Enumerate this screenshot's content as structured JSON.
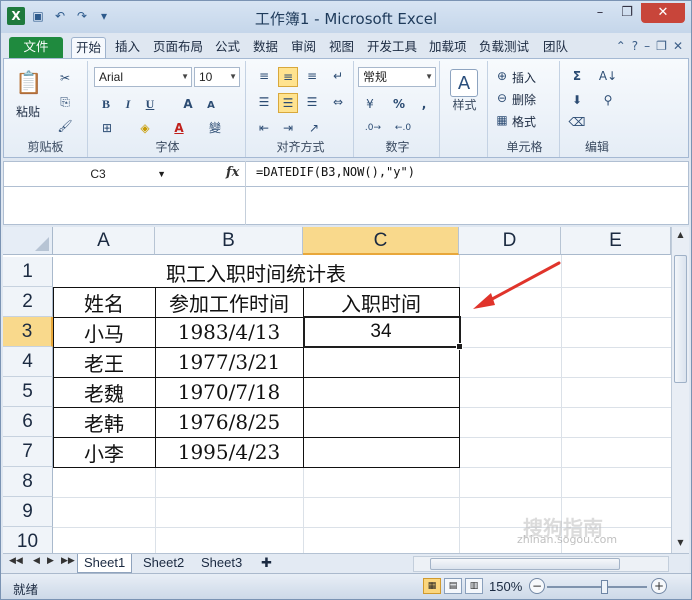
{
  "window": {
    "title": "工作簿1 - Microsoft Excel"
  },
  "ribbon_tabs": [
    "文件",
    "开始",
    "插入",
    "页面布局",
    "公式",
    "数据",
    "审阅",
    "视图",
    "开发工具",
    "加载项",
    "负载测试",
    "团队"
  ],
  "ribbon": {
    "clipboard": {
      "paste": "粘贴",
      "label": "剪贴板"
    },
    "font": {
      "name": "Arial",
      "size": "10",
      "bold": "B",
      "italic": "I",
      "underline": "U",
      "grow": "A",
      "shrink": "A",
      "font_color": "A",
      "phonetic": "變",
      "label": "字体"
    },
    "alignment": {
      "label": "对齐方式"
    },
    "number": {
      "format": "常规",
      "percent": "%",
      "comma": ",",
      "label": "数字"
    },
    "styles": {
      "label": "样式"
    },
    "cells": {
      "insert": "插入",
      "delete": "删除",
      "format": "格式",
      "label": "单元格"
    },
    "editing": {
      "label": "编辑"
    }
  },
  "formula_bar": {
    "name_box": "C3",
    "fx": "fx",
    "formula": "=DATEDIF(B3,NOW(),\"y\")"
  },
  "columns": [
    "A",
    "B",
    "C",
    "D",
    "E"
  ],
  "rows": [
    "1",
    "2",
    "3",
    "4",
    "5",
    "6",
    "7",
    "8",
    "9",
    "10"
  ],
  "table": {
    "title": "职工入职时间统计表",
    "headers": [
      "姓名",
      "参加工作时间",
      "入职时间"
    ],
    "rows": [
      {
        "name": "小马",
        "date": "1983/4/13",
        "years": "34"
      },
      {
        "name": "老王",
        "date": "1977/3/21",
        "years": ""
      },
      {
        "name": "老魏",
        "date": "1970/7/18",
        "years": ""
      },
      {
        "name": "老韩",
        "date": "1976/8/25",
        "years": ""
      },
      {
        "name": "小李",
        "date": "1995/4/23",
        "years": ""
      }
    ]
  },
  "sheet_tabs": [
    "Sheet1",
    "Sheet2",
    "Sheet3"
  ],
  "status": {
    "ready": "就绪",
    "zoom": "150%"
  },
  "watermark": {
    "brand": "搜狗指南",
    "url": "zhinan.sogou.com"
  },
  "colors": {
    "accent_green": "#1f8a3e",
    "selection_orange": "#f9d98c",
    "arrow_red": "#e0342b"
  }
}
